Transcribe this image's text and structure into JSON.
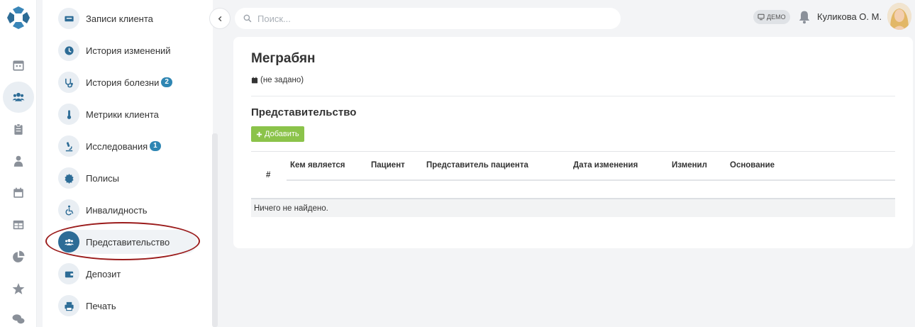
{
  "rail": {
    "items": [
      {
        "name": "calendar-icon"
      },
      {
        "name": "clients-icon",
        "active": true
      },
      {
        "name": "clipboard-icon"
      },
      {
        "name": "doctor-icon"
      },
      {
        "name": "schedule-icon"
      },
      {
        "name": "table-icon"
      },
      {
        "name": "pie-chart-icon"
      },
      {
        "name": "star-icon"
      },
      {
        "name": "chat-icon"
      }
    ]
  },
  "menu": {
    "items": [
      {
        "label": "Записи клиента",
        "icon": "id-card-icon"
      },
      {
        "label": "История изменений",
        "icon": "clock-icon"
      },
      {
        "label": "История болезни",
        "icon": "stethoscope-icon",
        "badge": "2"
      },
      {
        "label": "Метрики клиента",
        "icon": "thermometer-icon"
      },
      {
        "label": "Исследования",
        "icon": "microscope-icon",
        "badge": "1"
      },
      {
        "label": "Полисы",
        "icon": "certificate-icon"
      },
      {
        "label": "Инвалидность",
        "icon": "wheelchair-icon"
      },
      {
        "label": "Представительство",
        "icon": "users-icon",
        "active": true
      },
      {
        "label": "Депозит",
        "icon": "wallet-icon"
      },
      {
        "label": "Печать",
        "icon": "printer-icon"
      }
    ]
  },
  "search": {
    "placeholder": "Поиск..."
  },
  "header": {
    "demo_label": "ДЕМО",
    "user_name": "Куликова О. М."
  },
  "patient": {
    "name": "Меграбян",
    "birth_date": "(не задано)"
  },
  "section": {
    "title": "Представительство",
    "add_label": "Добавить"
  },
  "table": {
    "hash": "#",
    "columns": [
      "Кем является",
      "Пациент",
      "Представитель пациента",
      "Дата изменения",
      "Изменил",
      "Основание"
    ],
    "empty_text": "Ничего не найдено."
  },
  "colors": {
    "accent": "#2d6c96",
    "badge": "#2f86b3",
    "add_button": "#8bc34a",
    "highlight": "#9b1c1c"
  }
}
